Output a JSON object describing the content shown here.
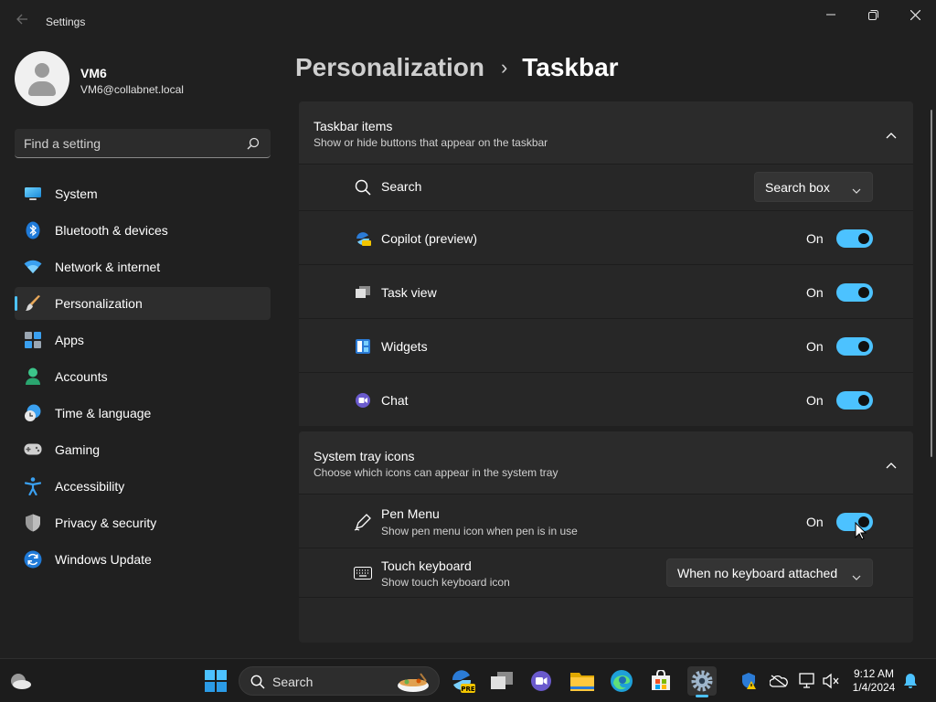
{
  "window": {
    "title": "Settings"
  },
  "user": {
    "name": "VM6",
    "email": "VM6@collabnet.local"
  },
  "search": {
    "placeholder": "Find a setting"
  },
  "nav": {
    "items": [
      {
        "label": "System",
        "icon": "monitor-icon"
      },
      {
        "label": "Bluetooth & devices",
        "icon": "bluetooth-icon"
      },
      {
        "label": "Network & internet",
        "icon": "wifi-icon"
      },
      {
        "label": "Personalization",
        "icon": "brush-icon",
        "active": true
      },
      {
        "label": "Apps",
        "icon": "apps-icon"
      },
      {
        "label": "Accounts",
        "icon": "person-icon"
      },
      {
        "label": "Time & language",
        "icon": "clock-globe-icon"
      },
      {
        "label": "Gaming",
        "icon": "gamepad-icon"
      },
      {
        "label": "Accessibility",
        "icon": "accessibility-icon"
      },
      {
        "label": "Privacy & security",
        "icon": "shield-icon"
      },
      {
        "label": "Windows Update",
        "icon": "update-icon"
      }
    ]
  },
  "breadcrumb": {
    "parent": "Personalization",
    "separator": "›",
    "current": "Taskbar"
  },
  "taskbar_items": {
    "title": "Taskbar items",
    "description": "Show or hide buttons that appear on the taskbar",
    "search": {
      "label": "Search",
      "value": "Search box"
    },
    "toggles": [
      {
        "label": "Copilot (preview)",
        "state": "On",
        "on": true,
        "icon": "copilot-icon"
      },
      {
        "label": "Task view",
        "state": "On",
        "on": true,
        "icon": "task-view-icon"
      },
      {
        "label": "Widgets",
        "state": "On",
        "on": true,
        "icon": "widgets-icon"
      },
      {
        "label": "Chat",
        "state": "On",
        "on": true,
        "icon": "chat-icon"
      }
    ]
  },
  "system_tray": {
    "title": "System tray icons",
    "description": "Choose which icons can appear in the system tray",
    "pen_menu": {
      "label": "Pen Menu",
      "sub": "Show pen menu icon when pen is in use",
      "state": "On",
      "on": true
    },
    "touch_keyboard": {
      "label": "Touch keyboard",
      "sub": "Show touch keyboard icon",
      "value": "When no keyboard attached"
    }
  },
  "taskbar": {
    "search_label": "Search",
    "time": "9:12 AM",
    "date": "1/4/2024",
    "copilot_badge": "PRE"
  },
  "colors": {
    "accent": "#4cc2ff",
    "background": "#202020",
    "card": "#2b2b2b"
  }
}
